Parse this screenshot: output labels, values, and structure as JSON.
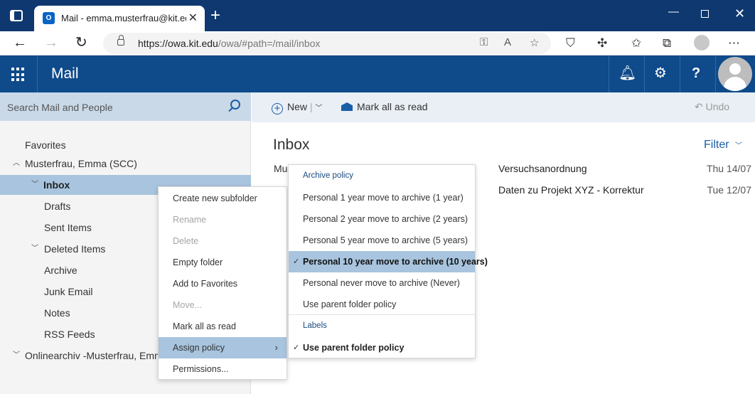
{
  "browser": {
    "tab_title": "Mail - emma.musterfrau@kit.edu",
    "close_glyph": "✕",
    "new_tab_glyph": "+",
    "url_host": "https://owa.kit.edu",
    "url_path": "/owa/#path=/mail/inbox",
    "icons": [
      "tabs-icon",
      "outlook-favicon",
      "back-icon",
      "forward-icon",
      "reload-icon",
      "lock-icon",
      "key-icon",
      "read-aloud-icon",
      "favorites-add-icon",
      "pocket-icon",
      "extensions-icon",
      "favorites-icon",
      "collections-icon",
      "profile-icon",
      "more-icon"
    ]
  },
  "header": {
    "app_title": "Mail",
    "accent_color": "#0f4a8a",
    "icons": [
      "app-launcher-icon",
      "bell-icon",
      "gear-icon",
      "help-icon",
      "user-avatar"
    ]
  },
  "search": {
    "placeholder": "Search Mail and People"
  },
  "folders": [
    {
      "label": "Favorites"
    },
    {
      "label": "Musterfrau, Emma (SCC)"
    },
    {
      "label": "Inbox"
    },
    {
      "label": "Drafts"
    },
    {
      "label": "Sent Items"
    },
    {
      "label": "Deleted Items"
    },
    {
      "label": "Archive"
    },
    {
      "label": "Junk Email"
    },
    {
      "label": "Notes"
    },
    {
      "label": "RSS Feeds"
    },
    {
      "label": "Onlinearchiv -Musterfrau, Emma"
    }
  ],
  "toolbar": {
    "new_label": "New",
    "mark_all_read_label": "Mark all as read",
    "undo_label": "Undo"
  },
  "mail_list": {
    "title": "Inbox",
    "filter_label": "Filter",
    "rows": [
      {
        "sender": "Mu",
        "subject": "Versuchsanordnung",
        "date": "Thu 14/07"
      },
      {
        "sender": "",
        "subject": "Daten zu Projekt XYZ - Korrektur",
        "date": "Tue 12/07"
      }
    ]
  },
  "context_menu": {
    "items": [
      {
        "label": "Create new subfolder",
        "state": "enabled"
      },
      {
        "label": "Rename",
        "state": "disabled"
      },
      {
        "label": "Delete",
        "state": "disabled"
      },
      {
        "label": "Empty folder",
        "state": "enabled"
      },
      {
        "label": "Add to Favorites",
        "state": "enabled"
      },
      {
        "label": "Move...",
        "state": "disabled"
      },
      {
        "label": "Mark all as read",
        "state": "enabled"
      },
      {
        "label": "Assign policy",
        "state": "active"
      },
      {
        "label": "Permissions...",
        "state": "enabled"
      }
    ]
  },
  "policy_menu": {
    "archive_header": "Archive policy",
    "archive_items": [
      {
        "label": "Personal 1 year move to archive (1 year)",
        "checked": false
      },
      {
        "label": "Personal 2 year move to archive (2 years)",
        "checked": false
      },
      {
        "label": "Personal 5 year move to archive (5 years)",
        "checked": false
      },
      {
        "label": "Personal 10 year move to archive (10 years)",
        "checked": true
      },
      {
        "label": "Personal never move to archive (Never)",
        "checked": false
      },
      {
        "label": "Use parent folder policy",
        "checked": false
      }
    ],
    "labels_header": "Labels",
    "labels_items": [
      {
        "label": "Use parent folder policy",
        "checked": true
      }
    ]
  }
}
